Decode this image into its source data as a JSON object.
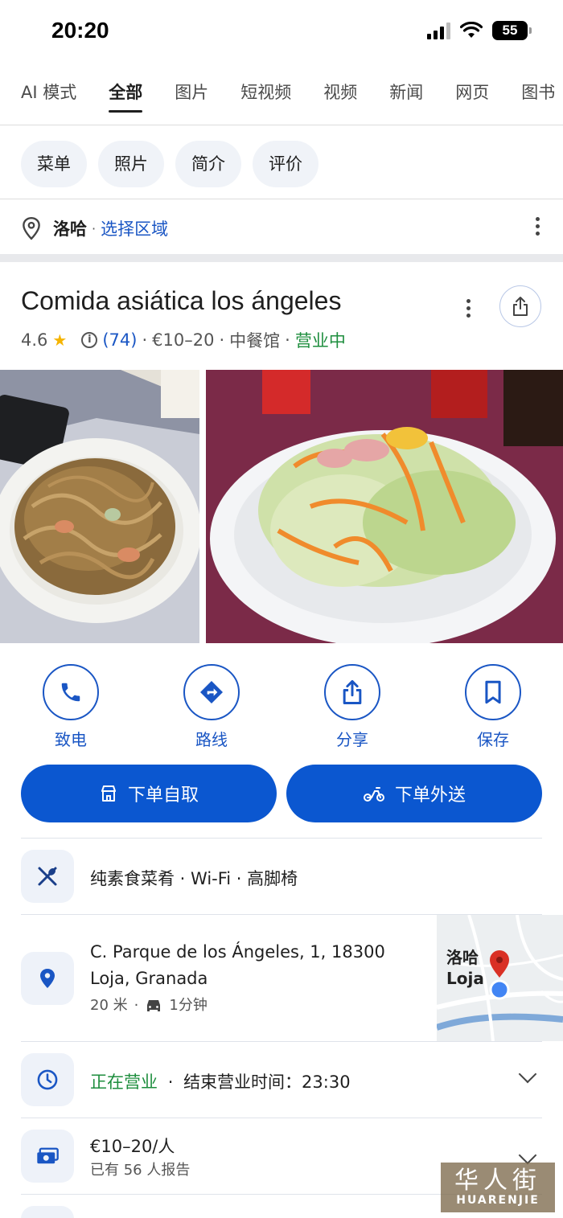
{
  "status_bar": {
    "time": "20:20",
    "battery": "55"
  },
  "tabs": [
    {
      "label": "AI 模式",
      "active": false
    },
    {
      "label": "全部",
      "active": true
    },
    {
      "label": "图片",
      "active": false
    },
    {
      "label": "短视频",
      "active": false
    },
    {
      "label": "视频",
      "active": false
    },
    {
      "label": "新闻",
      "active": false
    },
    {
      "label": "网页",
      "active": false
    },
    {
      "label": "图书",
      "active": false
    }
  ],
  "chips": [
    "菜单",
    "照片",
    "简介",
    "评价"
  ],
  "location": {
    "name": "洛哈",
    "separator": "·",
    "link": "选择区域"
  },
  "place": {
    "name": "Comida asiática los ángeles",
    "rating": "4.6",
    "reviews": "(74)",
    "price": "€10–20",
    "category": "中餐馆",
    "status": "营业中"
  },
  "actions": [
    {
      "label": "致电",
      "icon": "phone-icon"
    },
    {
      "label": "路线",
      "icon": "directions-icon"
    },
    {
      "label": "分享",
      "icon": "share-icon"
    },
    {
      "label": "保存",
      "icon": "bookmark-icon"
    }
  ],
  "order_buttons": {
    "pickup": "下单自取",
    "delivery": "下单外送"
  },
  "features": "纯素食菜肴 · Wi-Fi · 高脚椅",
  "address": {
    "line1": "C. Parque de los Ángeles, 1, 18300",
    "line2": "Loja, Granada",
    "distance": "20 米",
    "drive_time": "1分钟",
    "map_label_cn": "洛哈",
    "map_label": "Loja"
  },
  "hours": {
    "status": "正在营业",
    "detail": "结束营业时间：23:30"
  },
  "price_row": {
    "value": "€10–20/人",
    "reports": "已有 56 人报告"
  },
  "watermark": {
    "big": "华人街",
    "small": "HUARENJIE"
  },
  "colors": {
    "accent": "#0b57d0",
    "link": "#1a56c4",
    "open": "#1e8e3e",
    "star": "#f5b400"
  }
}
